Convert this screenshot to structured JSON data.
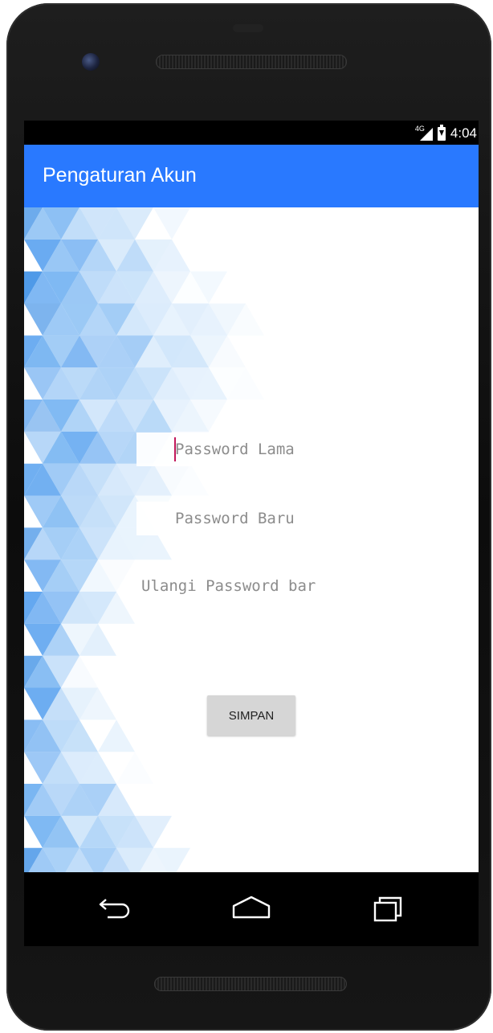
{
  "status_bar": {
    "network": "4G",
    "time": "4:04"
  },
  "app_bar": {
    "title": "Pengaturan Akun"
  },
  "form": {
    "old_password_placeholder": "Password Lama",
    "new_password_placeholder": "Password Baru",
    "confirm_password_placeholder": "Ulangi Password bar",
    "save_label": "SIMPAN"
  },
  "colors": {
    "app_bar": "#2979ff",
    "cursor": "#c2185b",
    "button": "#d6d6d6",
    "pattern_blue": "#64a8f0"
  },
  "nav": {
    "icons": [
      "back-icon",
      "home-icon",
      "recents-icon"
    ]
  }
}
